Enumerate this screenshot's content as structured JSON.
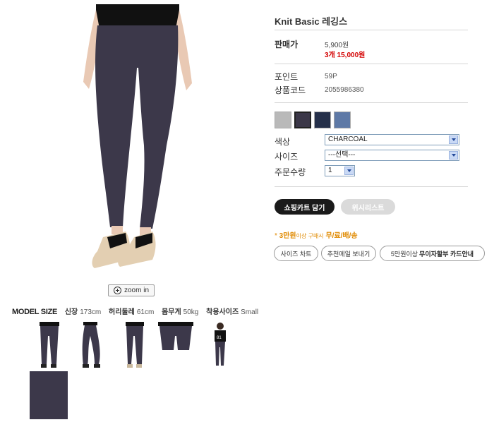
{
  "product": {
    "title": "Knit Basic 레깅스",
    "price_label": "판매가",
    "price": "5,900원",
    "bulk_price": "3개  15,000원",
    "point_label": "포인트",
    "point_value": "59P",
    "code_label": "상품코드",
    "code_value": "2055986380"
  },
  "swatches": [
    {
      "name": "gray",
      "color": "#b9b9b9",
      "selected": false
    },
    {
      "name": "charcoal",
      "color": "#3b3748",
      "selected": true
    },
    {
      "name": "navy",
      "color": "#25304a",
      "selected": false
    },
    {
      "name": "denim",
      "color": "#5e79a6",
      "selected": false
    }
  ],
  "options": {
    "color_label": "색상",
    "color_value": "CHARCOAL",
    "size_label": "사이즈",
    "size_value": "---선택---",
    "qty_label": "주문수량",
    "qty_value": "1"
  },
  "buttons": {
    "cart": "쇼핑카트 담기",
    "wishlist": "위시리스트",
    "size_chart": "사이즈 차트",
    "recommend_mail": "추천메일 보내기",
    "card_prefix": "5만원이상",
    "card_bold": "무이자할부 카드안내"
  },
  "notice": {
    "star": "* ",
    "amount": "3만원",
    "middle": "이상 구매시",
    "free": "무/료/배/송"
  },
  "zoom": {
    "label": "zoom in"
  },
  "model": {
    "title": "MODEL SIZE",
    "height_label": "신장",
    "height": "173cm",
    "waist_label": "허리둘레",
    "waist": "61cm",
    "weight_label": "몸무게",
    "weight": "50kg",
    "fit_label": "착용사이즈",
    "fit": "Small"
  },
  "colors": {
    "legging": "#3c384a",
    "top": "#111111",
    "sale_red": "#d40000",
    "notice_orange": "#e08a00"
  }
}
